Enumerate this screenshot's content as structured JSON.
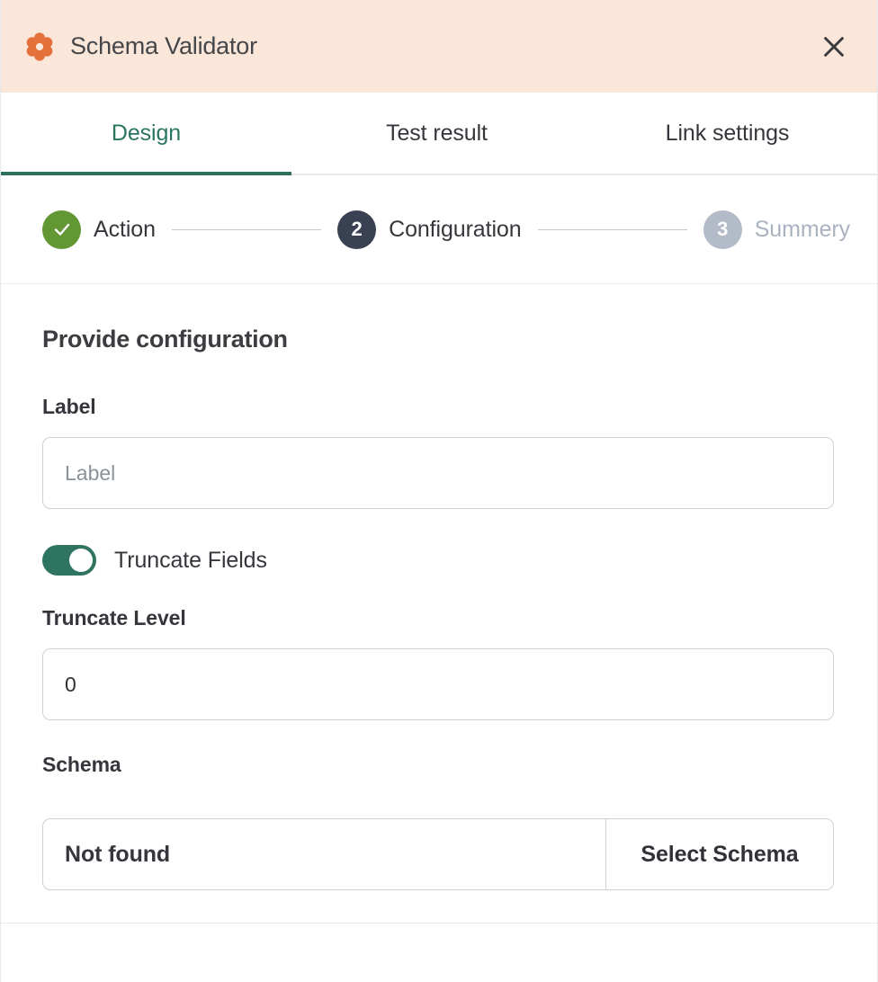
{
  "header": {
    "icon": "flower-gear-icon",
    "title": "Schema Validator",
    "close_icon": "close-icon",
    "background": "#FAE7DA",
    "accent": "#E0enough"
  },
  "theme": {
    "header_bg": "#FAE7DA",
    "brand_orange": "#E4703A",
    "active_tab_green": "#2A7561",
    "toggle_green": "#2F7461",
    "step_done_green": "#629733",
    "step_current_navy": "#3A4152",
    "step_upcoming_gray": "#B4BBC8"
  },
  "tabs": [
    {
      "label": "Design",
      "active": true
    },
    {
      "label": "Test result",
      "active": false
    },
    {
      "label": "Link settings",
      "active": false
    }
  ],
  "stepper": [
    {
      "number": "1",
      "label": "Action",
      "state": "done",
      "icon": "check-icon"
    },
    {
      "number": "2",
      "label": "Configuration",
      "state": "current"
    },
    {
      "number": "3",
      "label": "Summery",
      "state": "upcoming"
    }
  ],
  "main": {
    "section_title": "Provide configuration",
    "label_field": {
      "label": "Label",
      "value": "",
      "placeholder": "Label"
    },
    "truncate_fields_toggle": {
      "label": "Truncate Fields",
      "enabled": true
    },
    "truncate_level_field": {
      "label": "Truncate Level",
      "value": "0"
    },
    "schema_field": {
      "label": "Schema",
      "value": "Not found",
      "button_label": "Select Schema"
    }
  }
}
